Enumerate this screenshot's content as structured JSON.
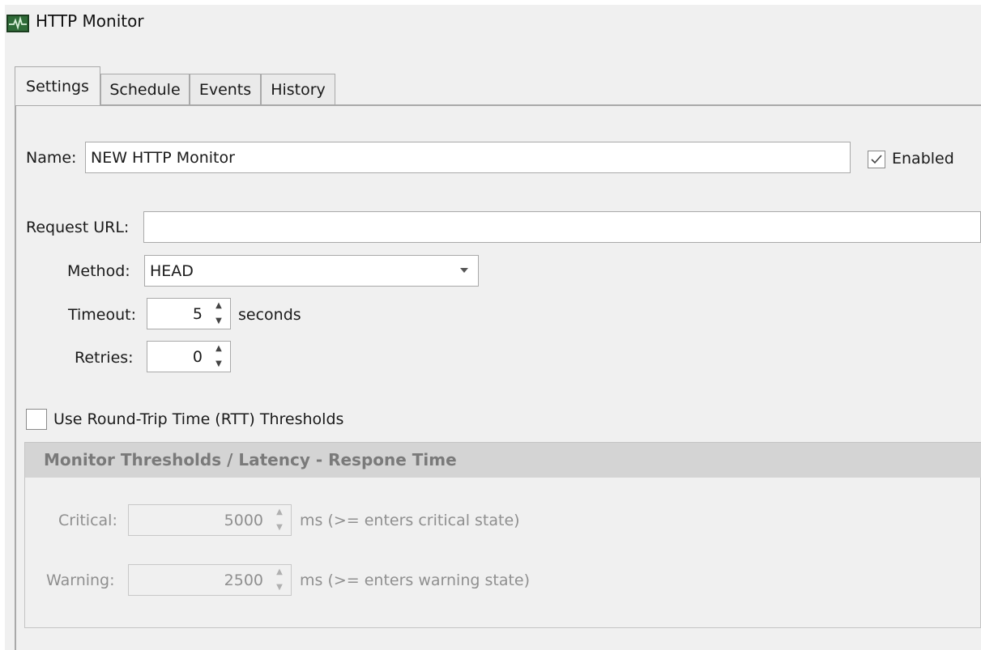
{
  "window": {
    "title": "HTTP Monitor",
    "icon": "activity-monitor-icon"
  },
  "tabs": [
    {
      "label": "Settings",
      "active": true
    },
    {
      "label": "Schedule",
      "active": false
    },
    {
      "label": "Events",
      "active": false
    },
    {
      "label": "History",
      "active": false
    }
  ],
  "settings": {
    "name_label": "Name:",
    "name_value": "NEW HTTP Monitor",
    "enabled_label": "Enabled",
    "enabled_checked": true,
    "url_label": "Request URL:",
    "url_value": "",
    "method_label": "Method:",
    "method_value": "HEAD",
    "timeout_label": "Timeout:",
    "timeout_value": "5",
    "timeout_unit": "seconds",
    "retries_label": "Retries:",
    "retries_value": "0",
    "rtt_label": "Use Round-Trip Time (RTT) Thresholds",
    "rtt_checked": false
  },
  "thresholds": {
    "title": "Monitor Thresholds / Latency - Respone Time",
    "critical_label": "Critical:",
    "critical_value": "5000",
    "critical_note": "ms (>= enters critical state)",
    "warning_label": "Warning:",
    "warning_value": "2500",
    "warning_note": "ms (>= enters warning state)"
  },
  "colors": {
    "dialog_bg": "#f0f0f0",
    "group_header_bg": "#d4d4d4",
    "disabled_text": "#8f8f8f"
  }
}
